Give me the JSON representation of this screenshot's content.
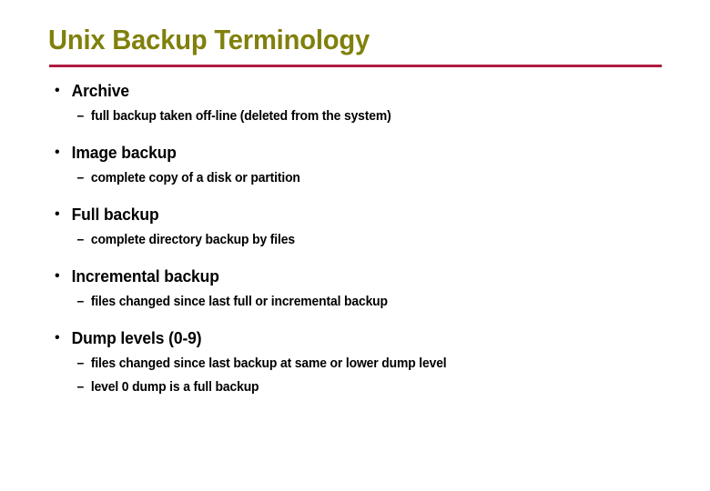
{
  "slide": {
    "title": "Unix Backup Terminology",
    "title_color": "#80800c",
    "rule_color": "#b01c3e",
    "background_color": "#ffffff",
    "text_color": "#000000",
    "bullet_marker": "•",
    "subbullet_marker": "–",
    "items": [
      {
        "label": "Archive",
        "sub": [
          "full backup taken off-line (deleted from the system)"
        ]
      },
      {
        "label": "Image backup",
        "sub": [
          "complete copy of a disk or partition"
        ]
      },
      {
        "label": "Full backup",
        "sub": [
          "complete directory backup by files"
        ]
      },
      {
        "label": "Incremental backup",
        "sub": [
          "files changed since last full or incremental backup"
        ]
      },
      {
        "label": "Dump levels (0-9)",
        "sub": [
          "files changed since last backup at same or lower dump level",
          "level 0 dump is a full backup"
        ]
      }
    ]
  }
}
